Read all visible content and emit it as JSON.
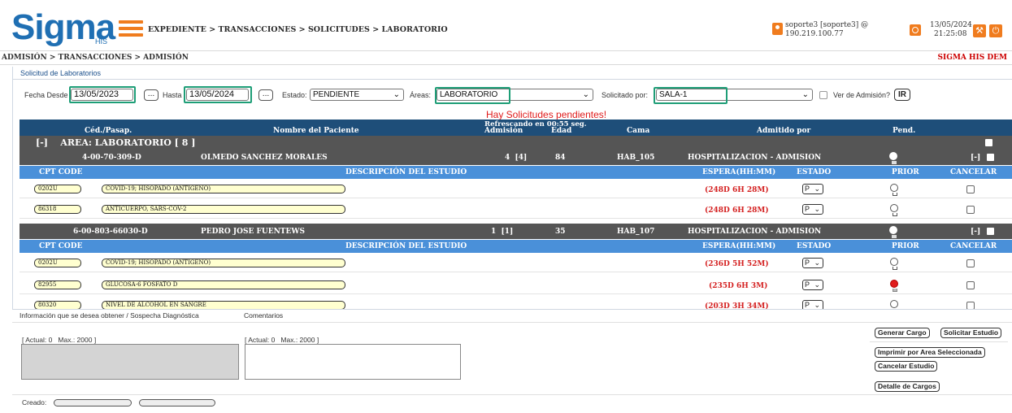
{
  "header": {
    "logo_text": "Sigma",
    "logo_sub": "HIS",
    "breadcrumb": "EXPEDIENTE > TRANSACCIONES > SOLICITUDES > LABORATORIO",
    "user_line1": "soporte3 [soporte3] @",
    "user_line2": "190.219.100.77",
    "date": "13/05/2024",
    "time": "21:25:08"
  },
  "subbar": {
    "breadcrumb": "ADMISIÓN > TRANSACCIONES > ADMISIÓN",
    "brand": "SIGMA HIS DEM"
  },
  "panel": {
    "title": "Solicitud de Laboratorios"
  },
  "filters": {
    "fecha_desde_label": "Fecha Desde",
    "fecha_desde": "13/05/2023",
    "hasta_label": "Hasta",
    "hasta": "13/05/2024",
    "dots": "...",
    "estado_label": "Estado:",
    "estado": "PENDIENTE",
    "areas_label": "Áreas:",
    "areas": "LABORATORIO",
    "solicitado_label": "Solicitado por:",
    "solicitado": "SALA-1",
    "ver_label": "Ver de Admisión?",
    "ir": "IR"
  },
  "notice": "Hay Solicitudes pendientes!",
  "table": {
    "refresh": "Refrescando en 00:55 seg.",
    "headers": [
      "Céd./Pasap.",
      "Nombre del Paciente",
      "Admisión",
      "Edad",
      "Cama",
      "Admitido por",
      "Pend."
    ],
    "area": "[-]    AREA: LABORATORIO [ 8 ]",
    "sub_headers": [
      "CPT CODE",
      "DESCRIPCIÓN DEL ESTUDIO",
      "ESPERA(HH:MM)",
      "ESTADO",
      "PRIOR",
      "CANCELAR"
    ],
    "patients": [
      {
        "ced": "4-00-70-309-D",
        "name": "OLMEDO SANCHEZ MORALES",
        "admision": "4  [4]",
        "edad": "84",
        "cama": "HAB_105",
        "admitido": "HOSPITALIZACION - ADMISION",
        "toggle": "[-]",
        "items": [
          {
            "code": "0202U",
            "desc": "COVID-19; HISOPADO (ANTIGENO)",
            "wait": "(248D 6H 28M)",
            "estado": "P",
            "prior": "normal"
          },
          {
            "code": "86318",
            "desc": "ANTICUERPO, SARS-COV-2",
            "wait": "(248D 6H 28M)",
            "estado": "P",
            "prior": "normal"
          }
        ]
      },
      {
        "ced": "6-00-803-66030-D",
        "name": "PEDRO JOSE FUENTEWS",
        "admision": "1  [1]",
        "edad": "35",
        "cama": "HAB_107",
        "admitido": "HOSPITALIZACION - ADMISION",
        "toggle": "[-]",
        "items": [
          {
            "code": "0202U",
            "desc": "COVID-19; HISOPADO (ANTIGENO)",
            "wait": "(236D 5H 52M)",
            "estado": "P",
            "prior": "normal"
          },
          {
            "code": "82955",
            "desc": "GLUCOSA-6 FOSFATO D",
            "wait": "(235D 6H 3M)",
            "estado": "P",
            "prior": "urgent"
          },
          {
            "code": "80320",
            "desc": "NIVEL DE ALCOHOL EN SANGRE",
            "wait": "(203D 3H 34M)",
            "estado": "P",
            "prior": "normal"
          }
        ]
      }
    ]
  },
  "bottom": {
    "info_label": "Información que se desea obtener / Sospecha Diagnóstica",
    "comments_label": "Comentarios",
    "counter1": "[ Actual: 0   Max.: 2000 ]",
    "counter2": "[ Actual: 0   Max.: 2000 ]",
    "created_label": "Creado:",
    "buttons": {
      "generar": "Generar Cargo",
      "solicitar": "Solicitar Estudio",
      "imprimir": "Imprimir por Area Seleccionada",
      "cancelar": "Cancelar Estudio",
      "detalle": "Detalle de Cargos"
    }
  },
  "colors": {
    "brand_blue": "#1f6fb3",
    "accent_orange": "#f07c1e",
    "table_header": "#1e4e79",
    "row_dark": "#555555",
    "sub_header_blue": "#4a90d9",
    "alert_red": "#e01b1b",
    "highlight_green": "#1e9e77"
  }
}
